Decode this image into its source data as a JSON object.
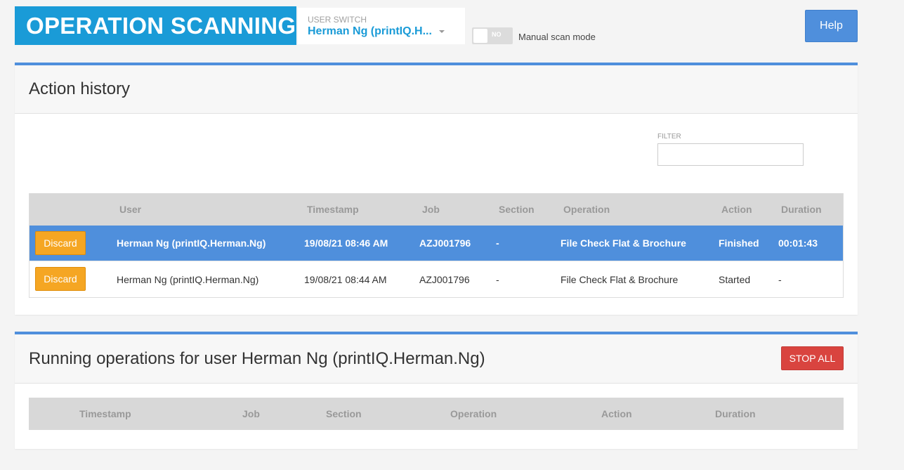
{
  "header": {
    "brand": "OPERATION SCANNING",
    "user_switch": {
      "label": "USER SWITCH",
      "value": "Herman Ng (printIQ.H..."
    },
    "manual_scan": {
      "toggle_text": "NO",
      "label": "Manual scan mode"
    },
    "help_label": "Help"
  },
  "action_history": {
    "title": "Action history",
    "filter": {
      "label": "FILTER",
      "value": ""
    },
    "columns": [
      "User",
      "Timestamp",
      "Job",
      "Section",
      "Operation",
      "Action",
      "Duration"
    ],
    "rows": [
      {
        "button": "Discard",
        "user": "Herman Ng (printIQ.Herman.Ng)",
        "timestamp": "19/08/21 08:46 AM",
        "job": "AZJ001796",
        "section": "-",
        "operation": "File Check Flat & Brochure",
        "action": "Finished",
        "duration": "00:01:43",
        "selected": true
      },
      {
        "button": "Discard",
        "user": "Herman Ng (printIQ.Herman.Ng)",
        "timestamp": "19/08/21 08:44 AM",
        "job": "AZJ001796",
        "section": "-",
        "operation": "File Check Flat & Brochure",
        "action": "Started",
        "duration": "-",
        "selected": false
      }
    ]
  },
  "running_operations": {
    "title": "Running operations for user Herman Ng (printIQ.Herman.Ng)",
    "stop_all_label": "STOP ALL",
    "columns": [
      "Timestamp",
      "Job",
      "Section",
      "Operation",
      "Action",
      "Duration"
    ]
  },
  "colors": {
    "brand": "#1a9bd7",
    "accent": "#4f8fdc",
    "discard": "#f5a623",
    "stop": "#d9443f"
  }
}
